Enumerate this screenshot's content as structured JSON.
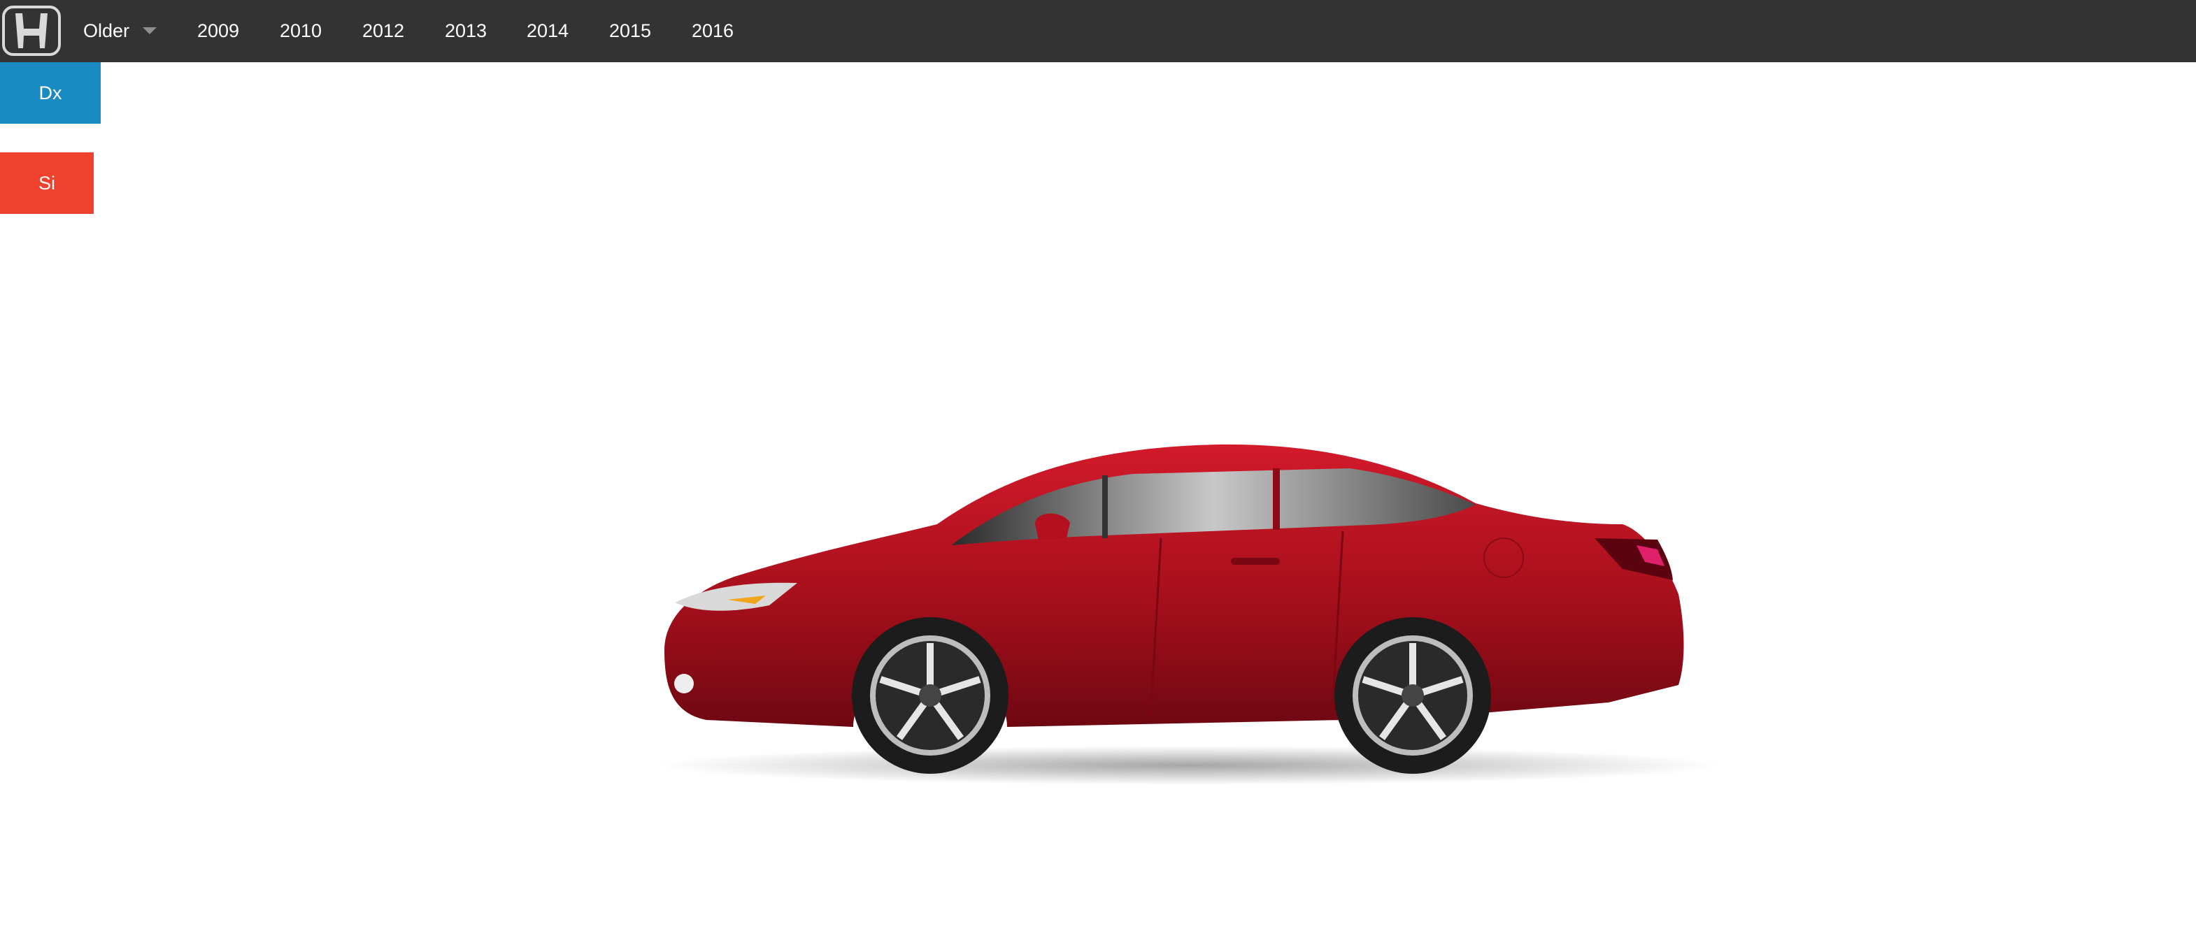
{
  "header": {
    "logo_icon": "honda-logo-icon",
    "background": "#333333",
    "dropdown": {
      "label": "Older",
      "icon": "caret-down-icon"
    },
    "years": [
      "2009",
      "2010",
      "2012",
      "2013",
      "2014",
      "2015",
      "2016"
    ]
  },
  "trims": [
    {
      "label": "Dx",
      "color": "#1a8ac2"
    },
    {
      "label": "Si",
      "color": "#f0412c"
    }
  ],
  "vehicle": {
    "image": "red-coupe-side-view",
    "body_color": "#b3121f"
  }
}
